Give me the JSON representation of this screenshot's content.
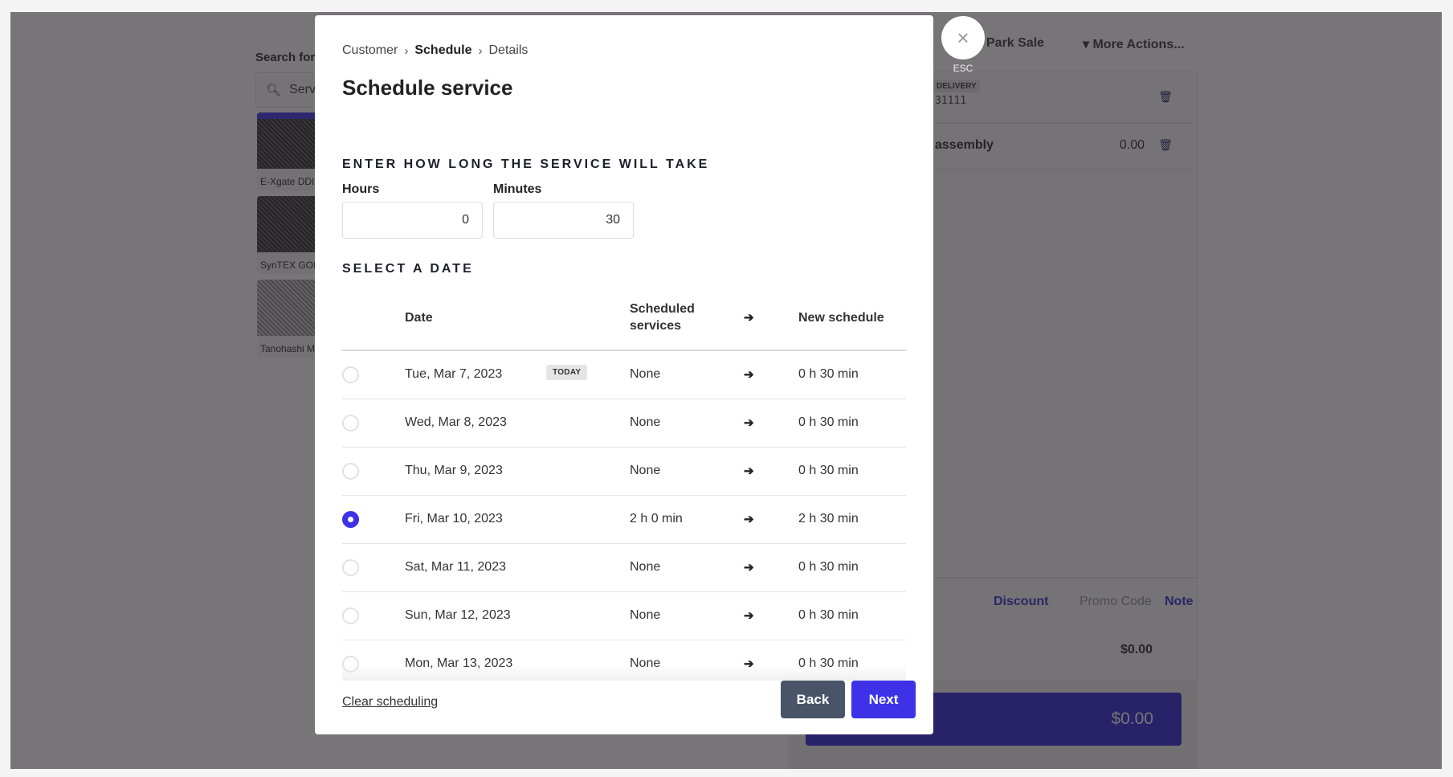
{
  "background": {
    "search_label": "Search for",
    "search_value": "Servi",
    "products": [
      "E-Xgate DDI",
      "SynTEX GOI",
      "Tanohashi M"
    ],
    "top_actions": {
      "park_sale": "Park Sale",
      "more_actions": "▾ More Actions..."
    },
    "cart": {
      "item1": {
        "tag": "DELIVERY",
        "sku": "31111"
      },
      "item2": {
        "name": "assembly",
        "amount": "0.00"
      }
    },
    "footer_links": {
      "discount": "Discount",
      "promo_code": "Promo Code",
      "note": "Note"
    },
    "subtotal": "$0.00",
    "pay_total": "$0.00"
  },
  "close": {
    "icon": "×",
    "label": "ESC"
  },
  "modal": {
    "breadcrumb": [
      {
        "label": "Customer",
        "current": false
      },
      {
        "label": "Schedule",
        "current": true
      },
      {
        "label": "Details",
        "current": false
      }
    ],
    "breadcrumb_sep": "›",
    "title": "Schedule service",
    "duration_section": "ENTER HOW LONG THE SERVICE WILL TAKE",
    "hours_label": "Hours",
    "hours_value": "0",
    "minutes_label": "Minutes",
    "minutes_value": "30",
    "date_section": "SELECT A DATE",
    "table": {
      "headers": {
        "date": "Date",
        "scheduled_line1": "Scheduled",
        "scheduled_line2": "services",
        "arrow": "➔",
        "new_schedule": "New schedule"
      },
      "today_badge": "TODAY",
      "arrow": "➔",
      "rows": [
        {
          "date": "Tue, Mar 7, 2023",
          "today": true,
          "scheduled": "None",
          "new_schedule": "0 h 30 min",
          "selected": false
        },
        {
          "date": "Wed, Mar 8, 2023",
          "today": false,
          "scheduled": "None",
          "new_schedule": "0 h 30 min",
          "selected": false
        },
        {
          "date": "Thu, Mar 9, 2023",
          "today": false,
          "scheduled": "None",
          "new_schedule": "0 h 30 min",
          "selected": false
        },
        {
          "date": "Fri, Mar 10, 2023",
          "today": false,
          "scheduled": "2 h 0 min",
          "new_schedule": "2 h 30 min",
          "selected": true
        },
        {
          "date": "Sat, Mar 11, 2023",
          "today": false,
          "scheduled": "None",
          "new_schedule": "0 h 30 min",
          "selected": false
        },
        {
          "date": "Sun, Mar 12, 2023",
          "today": false,
          "scheduled": "None",
          "new_schedule": "0 h 30 min",
          "selected": false
        },
        {
          "date": "Mon, Mar 13, 2023",
          "today": false,
          "scheduled": "None",
          "new_schedule": "0 h 30 min",
          "selected": false
        }
      ]
    },
    "clear_scheduling": "Clear scheduling",
    "back_label": "Back",
    "next_label": "Next"
  },
  "colors": {
    "accent": "#3d32e8",
    "back_button": "#4a5468",
    "overlay": "#767476"
  }
}
